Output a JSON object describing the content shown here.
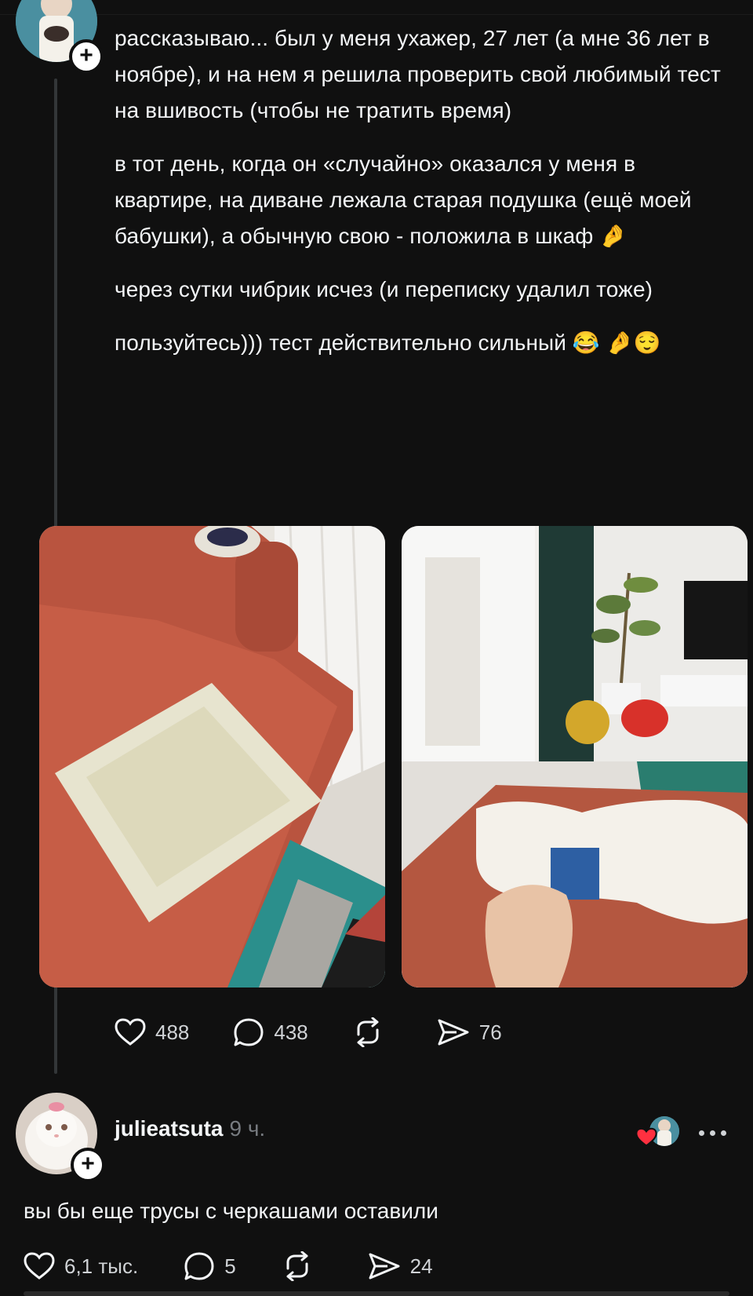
{
  "post": {
    "paragraphs": [
      "рассказываю... был у меня ухажер, 27 лет (а мне 36 лет в ноябре), и на нем я решила проверить свой любимый тест на вшивость (чтобы не тратить время)",
      "в тот день, когда он «случайно» оказался у меня в квартире, на диване лежала старая подушка (ещё моей бабушки), а обычную свою - положила в шкаф 🤌",
      "через сутки чибрик исчез (и переписку удалил тоже)",
      "пользуйтесь))) тест действительно сильный 😂 🤌😌"
    ],
    "likes": "488",
    "comments": "438",
    "shares": "76"
  },
  "reply": {
    "username": "julieatsuta",
    "time": "9 ч.",
    "text": "вы бы еще трусы с черкашами оставили",
    "likes": "6,1 тыс.",
    "comments": "5",
    "shares": "24"
  },
  "icons": {
    "like": "heart-icon",
    "comment": "speech-bubble-icon",
    "repost": "repost-icon",
    "share": "send-icon",
    "follow": "plus-icon",
    "more": "more-dots-icon",
    "liked_by_author": "red-heart-icon"
  },
  "colors": {
    "background": "#101010",
    "text": "#f3f5f7",
    "muted": "#777b80",
    "heart": "#ff3040"
  }
}
